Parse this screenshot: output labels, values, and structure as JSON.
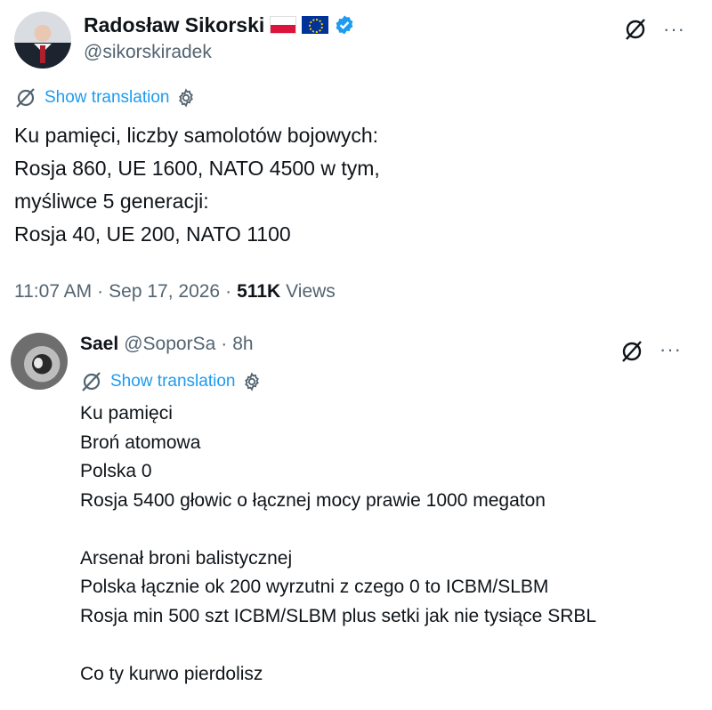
{
  "tweet": {
    "author_name": "Radosław Sikorski",
    "author_handle": "@sikorskiradek",
    "show_translation": "Show translation",
    "lines": [
      "Ku pamięci, liczby samolotów bojowych:",
      "Rosja 860, UE 1600, NATO 4500 w tym,",
      "myśliwce 5 generacji:",
      "Rosja 40, UE 200, NATO 1100"
    ],
    "time": "11:07 AM",
    "date": "Sep 17, 2026",
    "views_count": "511K",
    "views_label": "Views",
    "more_label": "···"
  },
  "reply": {
    "author_name": "Sael",
    "author_handle": "@SoporSa",
    "age": "8h",
    "show_translation": "Show translation",
    "lines": [
      "Ku pamięci",
      "Broń atomowa",
      "Polska 0",
      "Rosja 5400 głowic o łącznej mocy prawie 1000 megaton",
      "",
      "Arsenał broni balistycznej",
      "Polska łącznie ok 200 wyrzutni z czego 0 to ICBM/SLBM",
      "Rosja min 500 szt ICBM/SLBM plus setki jak nie tysiące SRBL",
      "",
      "Co ty kurwo pierdolisz"
    ],
    "more_label": "···"
  },
  "separators": {
    "dot": "·"
  }
}
